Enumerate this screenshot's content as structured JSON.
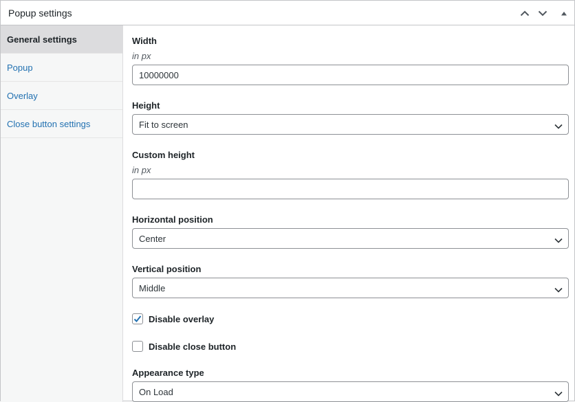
{
  "header": {
    "title": "Popup settings",
    "move_up_icon": "chevron-up-icon",
    "move_down_icon": "chevron-down-icon",
    "toggle_icon": "triangle-up-icon"
  },
  "sidebar": {
    "items": [
      {
        "label": "General settings",
        "active": true
      },
      {
        "label": "Popup",
        "active": false
      },
      {
        "label": "Overlay",
        "active": false
      },
      {
        "label": "Close button settings",
        "active": false
      }
    ]
  },
  "form": {
    "width": {
      "label": "Width",
      "hint": "in px",
      "value": "10000000"
    },
    "height": {
      "label": "Height",
      "selected": "Fit to screen"
    },
    "custom_height": {
      "label": "Custom height",
      "hint": "in px",
      "value": ""
    },
    "horizontal_position": {
      "label": "Horizontal position",
      "selected": "Center"
    },
    "vertical_position": {
      "label": "Vertical position",
      "selected": "Middle"
    },
    "disable_overlay": {
      "label": "Disable overlay",
      "checked": true
    },
    "disable_close_button": {
      "label": "Disable close button",
      "checked": false
    },
    "appearance_type": {
      "label": "Appearance type",
      "selected": "On Load"
    }
  },
  "colors": {
    "accent": "#2271b1",
    "border": "#8c8f94",
    "sidebar_bg": "#f6f7f7",
    "active_tab_bg": "#dcdcde"
  }
}
